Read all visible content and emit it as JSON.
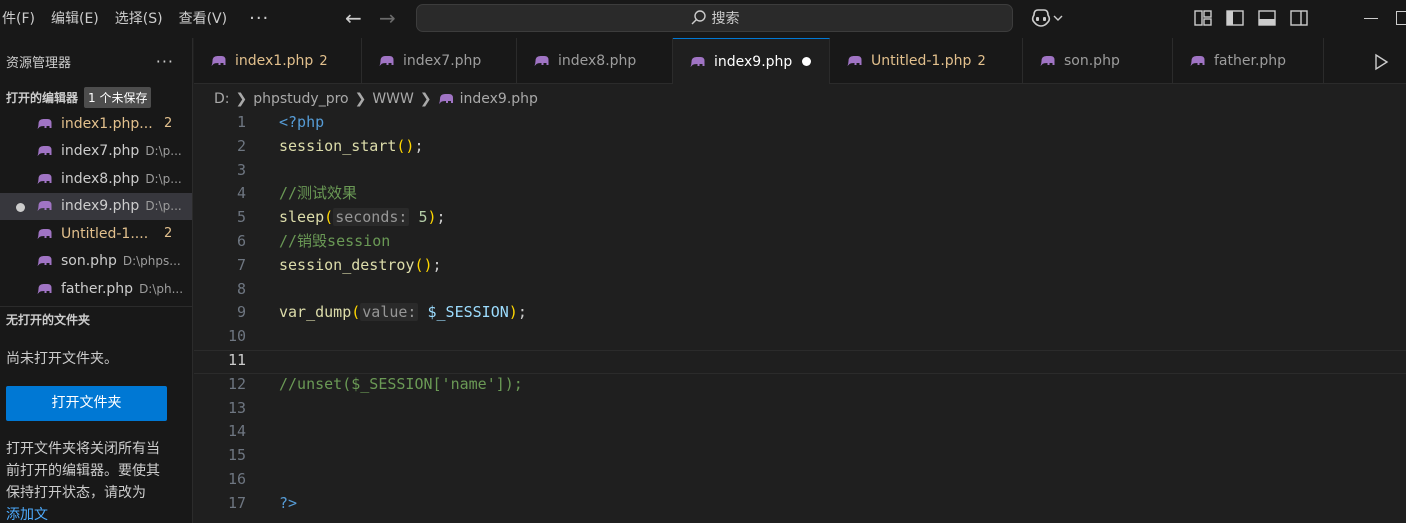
{
  "menu": {
    "file": "件(F)",
    "edit": "编辑(E)",
    "select": "选择(S)",
    "view": "查看(V)",
    "more": "···"
  },
  "search": {
    "label": "搜索"
  },
  "sidebar": {
    "title": "资源管理器",
    "more": "···",
    "open_editors_title": "打开的编辑器",
    "unsaved_badge": "1 个未保存",
    "open_editors": [
      {
        "name": "index1.php...",
        "path": "",
        "count": "2",
        "modified": true
      },
      {
        "name": "index7.php",
        "path": "D:\\p...",
        "count": "",
        "modified": false
      },
      {
        "name": "index8.php",
        "path": "D:\\p...",
        "count": "",
        "modified": false
      },
      {
        "name": "index9.php",
        "path": "D:\\p...",
        "count": "",
        "modified": false,
        "active": true
      },
      {
        "name": "Untitled-1....",
        "path": "",
        "count": "2",
        "modified": true
      },
      {
        "name": "son.php",
        "path": "D:\\phps...",
        "count": "",
        "modified": false
      },
      {
        "name": "father.php",
        "path": "D:\\ph...",
        "count": "",
        "modified": false
      }
    ],
    "no_folder_title": "无打开的文件夹",
    "no_folder_message": "尚未打开文件夹。",
    "open_folder_button": "打开文件夹",
    "help_text": "打开文件夹将关闭所有当前打开的编辑器。要使其保持打开状态，请改为",
    "help_link": "添加文"
  },
  "tabs": [
    {
      "label": "index1.php",
      "count": "2",
      "modified": true
    },
    {
      "label": "index7.php",
      "count": "",
      "modified": false
    },
    {
      "label": "index8.php",
      "count": "",
      "modified": false
    },
    {
      "label": "index9.php",
      "count": "",
      "modified": false,
      "active": true
    },
    {
      "label": "Untitled-1.php",
      "count": "2",
      "modified": true
    },
    {
      "label": "son.php",
      "count": "",
      "modified": false
    },
    {
      "label": "father.php",
      "count": "",
      "modified": false
    }
  ],
  "breadcrumb": {
    "drive": "D:",
    "folder1": "phpstudy_pro",
    "folder2": "WWW",
    "file": "index9.php"
  },
  "editor": {
    "line_numbers": [
      "1",
      "2",
      "3",
      "4",
      "5",
      "6",
      "7",
      "8",
      "9",
      "10",
      "11",
      "12",
      "13",
      "14",
      "15",
      "16",
      "17"
    ],
    "current_line": "11",
    "code": {
      "l1": "<?php",
      "l2_fn": "session_start",
      "l2_paren": "()",
      "l2_semi": ";",
      "l4": "//测试效果",
      "l5_fn": "sleep",
      "l5_open": "(",
      "l5_hint": "seconds:",
      "l5_num": "5",
      "l5_close": ")",
      "l5_semi": ";",
      "l6": "//销毁session",
      "l7_fn": "session_destroy",
      "l7_paren": "()",
      "l7_semi": ";",
      "l9_fn": "var_dump",
      "l9_open": "(",
      "l9_hint": "value:",
      "l9_var": "$_SESSION",
      "l9_close": ")",
      "l9_semi": ";",
      "l12": "//unset($_SESSION['name']);",
      "l17": "?>"
    }
  },
  "colors": {
    "accent": "#0078d4",
    "modified": "#e2c08d",
    "php_icon": "#a074c4"
  }
}
